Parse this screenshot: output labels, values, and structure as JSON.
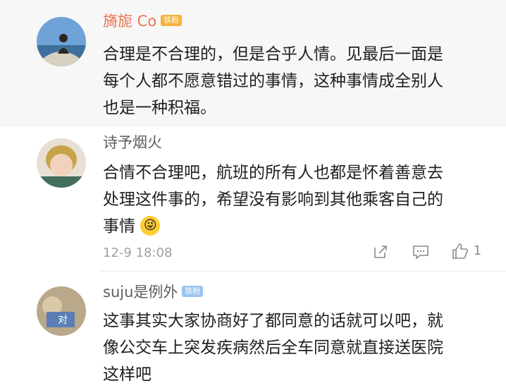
{
  "comments": [
    {
      "username": "旖旎 Co",
      "badge": "铁粉",
      "text_lines": [
        "合理是不合理的，但是合乎人情。见最后一面是",
        "每个人都不愿意错过的事情，这种事情成全别人",
        "也是一种积福。"
      ]
    },
    {
      "username": "诗予烟火",
      "text_lines": [
        "合情不合理吧，航班的所有人也都是怀着善意去",
        "处理这件事的，希望没有影响到其他乘客自己的",
        "事情"
      ],
      "emoji": "😜",
      "timestamp": "12-9 18:08",
      "like_count": "1"
    },
    {
      "username": "suju是例外",
      "badge": "铁粉",
      "text_lines": [
        "这事其实大家协商好了都同意的话就可以吧，就",
        "像公交车上突发疾病然后全车同意就直接送医院",
        "这样吧"
      ]
    }
  ],
  "icons": {
    "share": "share-icon",
    "comment": "comment-icon",
    "like": "thumbs-up-icon"
  },
  "colors": {
    "username_highlight": "#eb7350",
    "badge_gold": "#f3b43b",
    "badge_blue": "#9bc3ef",
    "shaded_bg": "#f7f7f7"
  }
}
